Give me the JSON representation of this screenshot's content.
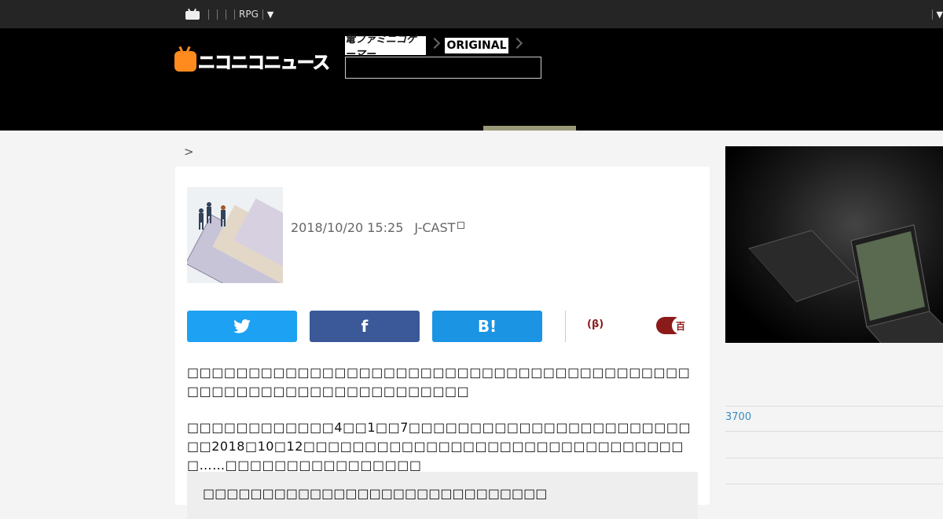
{
  "topbar": {
    "label_rpg": "RPG",
    "caret": "▼",
    "right_caret": "▼"
  },
  "header": {
    "logo_text": "ニコニコニュース",
    "breadcrumb_famitsu": "電ファミニコゲーマー",
    "breadcrumb_original": "ORIGINAL",
    "search_placeholder": ""
  },
  "breadcrumb": {
    "separator": ">"
  },
  "article": {
    "date": "2018/10/20 15:25",
    "source": "J-CAST",
    "share": {
      "twitter_icon": "twitter-bird-icon",
      "facebook_label": "f",
      "hatena_label": "B!"
    },
    "beta_label": "(β)",
    "toggle_label": "百",
    "paragraph1": "□□□□□□□□□□□□□□□□□□□□□□□□□□□□□□□□□□□□□□□□□□□□□□□□□□□□□□□□□□□□□□□□",
    "paragraph2": "□□□□□□□□□□□□4□□1□□7□□□□□□□□□□□□□□□□□□□□□□□□□2018□10□12□□□□□□□□□□□□□□□□□□□□□□□□□□□□□□□□……□□□□□□□□□□□□□□□□",
    "quote": "□□□□□□□□□□□□□□□□□□□□□□□□□□□□□"
  },
  "sidebar": {
    "rank_value": "3700"
  },
  "colors": {
    "twitter": "#1da1f2",
    "facebook": "#3b5998",
    "hatena": "#1a94e3",
    "accent_orange": "#ff8b1f",
    "beta_red": "#8b1a1a"
  }
}
